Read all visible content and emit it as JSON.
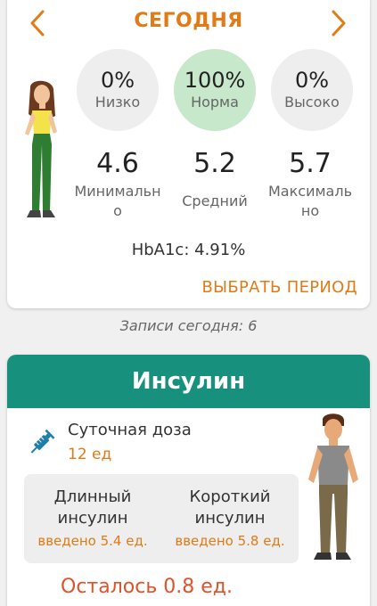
{
  "header": {
    "title": "СЕГОДНЯ"
  },
  "levels": {
    "low": {
      "percent": "0%",
      "label": "Низко"
    },
    "normal": {
      "percent": "100%",
      "label": "Норма"
    },
    "high": {
      "percent": "0%",
      "label": "Высоко"
    }
  },
  "stats": {
    "min": {
      "value": "4.6",
      "label": "Минимально"
    },
    "avg": {
      "value": "5.2",
      "label": "Средний"
    },
    "max": {
      "value": "5.7",
      "label": "Максимально"
    }
  },
  "hba1c": "HbA1c: 4.91%",
  "choose_period": "ВЫБРАТЬ ПЕРИОД",
  "records_today": "Записи сегодня: 6",
  "insulin": {
    "title": "Инсулин",
    "daily_label": "Суточная доза",
    "daily_value": "12 ед",
    "long": {
      "name": "Длинный инсулин",
      "given": "введено 5.4 ед."
    },
    "short": {
      "name": "Короткий инсулин",
      "given": "введено 5.8 ед."
    },
    "remaining": "Осталось 0.8 ед."
  },
  "colors": {
    "accent": "#e07b17",
    "teal": "#17917d",
    "normal_bg": "#c8e8cb",
    "remaining": "#e0522a"
  }
}
